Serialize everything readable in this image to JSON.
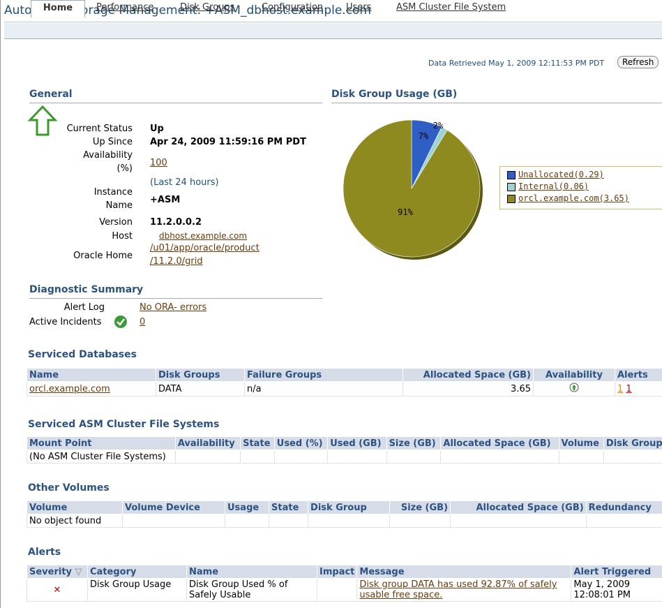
{
  "app": {
    "title": "Automatic Storage Management: +ASM_dbhost.example.com"
  },
  "tabs": [
    "Home",
    "Performance",
    "Disk Groups",
    "Configuration",
    "Users",
    "ASM Cluster File System"
  ],
  "header": {
    "data_retrieved": "Data Retrieved May 1, 2009 12:11:53 PM PDT",
    "refresh_label": "Refresh"
  },
  "general": {
    "title": "General",
    "current_status_label": "Current Status",
    "current_status": "Up",
    "up_since_label": "Up Since",
    "up_since": "Apr 24, 2009 11:59:16 PM PDT",
    "availability_label_1": "Availability",
    "availability_label_2": "(%)",
    "availability": "100",
    "last24": "(Last 24 hours)",
    "instance_label_1": "Instance",
    "instance_label_2": "Name",
    "instance": "+ASM",
    "version_label": "Version",
    "version": "11.2.0.0.2",
    "host_label": "Host",
    "host": "dbhost.example.com",
    "oracle_home_label": "Oracle Home",
    "oracle_home_1": "/u01/app/oracle/product",
    "oracle_home_2": "/11.2.0/grid"
  },
  "diag": {
    "title": "Diagnostic Summary",
    "alert_log_label": "Alert Log",
    "alert_log": "No ORA- errors",
    "incidents_label": "Active Incidents",
    "incidents": "0"
  },
  "chart_data": {
    "type": "pie",
    "title": "Disk Group Usage (GB)",
    "categories": [
      "Unallocated(0.29)",
      "Internal(0.06)",
      "orcl.example.com(3.65)"
    ],
    "values": [
      0.29,
      0.06,
      3.65
    ],
    "slice_labels": [
      "7%",
      "2%",
      "91%"
    ],
    "colors": [
      "#2f5fc4",
      "#9fd3cf",
      "#8f8a1f"
    ],
    "legend": "right"
  },
  "serviced_db": {
    "title": "Serviced Databases",
    "headers": [
      "Name",
      "Disk Groups",
      "Failure Groups",
      "Allocated Space (GB)",
      "Availability",
      "Alerts"
    ],
    "row": {
      "name": "orcl.example.com",
      "disk_groups": "DATA",
      "failure_groups": "n/a",
      "allocated": "3.65",
      "alert1": "1",
      "alert2": "1"
    }
  },
  "acfs": {
    "title": "Serviced ASM Cluster File Systems",
    "headers": [
      "Mount Point",
      "Availability",
      "State",
      "Used (%)",
      "Used (GB)",
      "Size (GB)",
      "Allocated Space (GB)",
      "Volume",
      "Disk Group"
    ],
    "empty": "(No ASM Cluster File Systems)"
  },
  "volumes": {
    "title": "Other Volumes",
    "headers": [
      "Volume",
      "Volume Device",
      "Usage",
      "State",
      "Disk Group",
      "Size (GB)",
      "Allocated Space (GB)",
      "Redundancy"
    ],
    "empty": "No object found"
  },
  "alerts": {
    "title": "Alerts",
    "headers": [
      "Severity",
      "Category",
      "Name",
      "Impact",
      "Message",
      "Alert Triggered"
    ],
    "row": {
      "category": "Disk Group Usage",
      "name_1": "Disk Group Used % of",
      "name_2": "Safely Usable",
      "message_1": "Disk group DATA has used 92.87% of safely",
      "message_2": "usable free space.",
      "triggered_1": "May 1, 2009",
      "triggered_2": "12:08:01 PM"
    }
  }
}
